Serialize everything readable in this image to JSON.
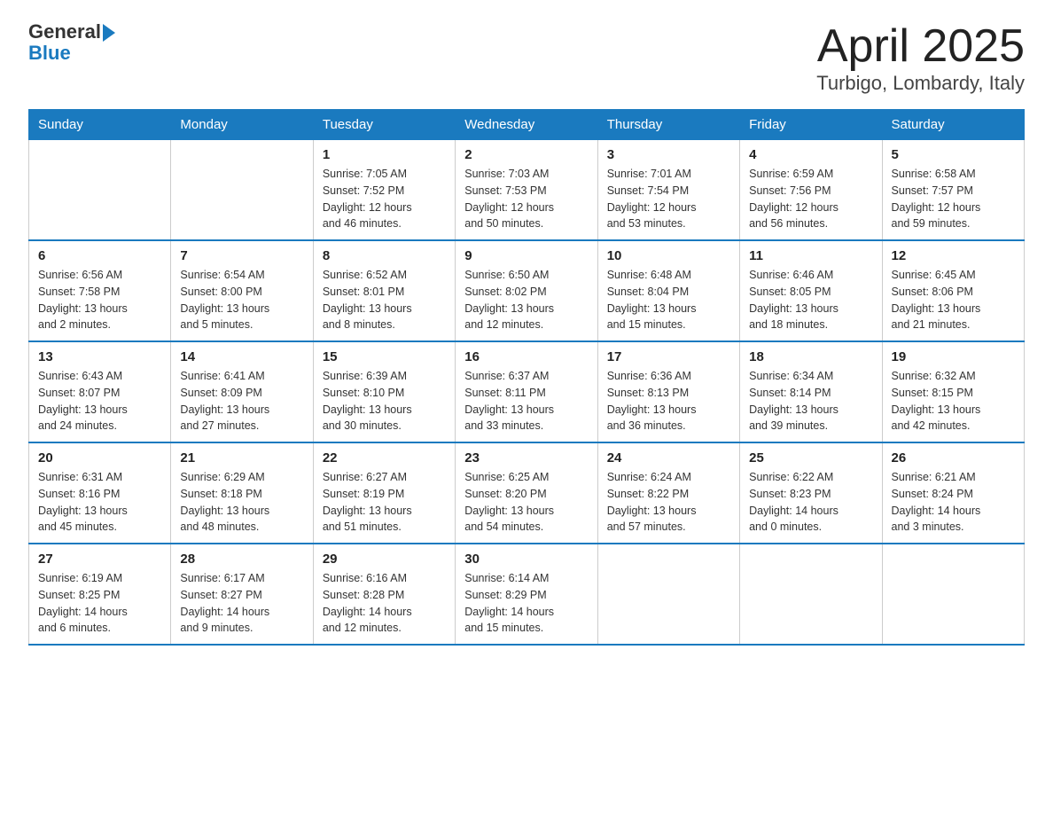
{
  "header": {
    "logo_general": "General",
    "logo_blue": "Blue",
    "title": "April 2025",
    "subtitle": "Turbigo, Lombardy, Italy"
  },
  "days_of_week": [
    "Sunday",
    "Monday",
    "Tuesday",
    "Wednesday",
    "Thursday",
    "Friday",
    "Saturday"
  ],
  "weeks": [
    [
      {
        "num": "",
        "info": ""
      },
      {
        "num": "",
        "info": ""
      },
      {
        "num": "1",
        "info": "Sunrise: 7:05 AM\nSunset: 7:52 PM\nDaylight: 12 hours\nand 46 minutes."
      },
      {
        "num": "2",
        "info": "Sunrise: 7:03 AM\nSunset: 7:53 PM\nDaylight: 12 hours\nand 50 minutes."
      },
      {
        "num": "3",
        "info": "Sunrise: 7:01 AM\nSunset: 7:54 PM\nDaylight: 12 hours\nand 53 minutes."
      },
      {
        "num": "4",
        "info": "Sunrise: 6:59 AM\nSunset: 7:56 PM\nDaylight: 12 hours\nand 56 minutes."
      },
      {
        "num": "5",
        "info": "Sunrise: 6:58 AM\nSunset: 7:57 PM\nDaylight: 12 hours\nand 59 minutes."
      }
    ],
    [
      {
        "num": "6",
        "info": "Sunrise: 6:56 AM\nSunset: 7:58 PM\nDaylight: 13 hours\nand 2 minutes."
      },
      {
        "num": "7",
        "info": "Sunrise: 6:54 AM\nSunset: 8:00 PM\nDaylight: 13 hours\nand 5 minutes."
      },
      {
        "num": "8",
        "info": "Sunrise: 6:52 AM\nSunset: 8:01 PM\nDaylight: 13 hours\nand 8 minutes."
      },
      {
        "num": "9",
        "info": "Sunrise: 6:50 AM\nSunset: 8:02 PM\nDaylight: 13 hours\nand 12 minutes."
      },
      {
        "num": "10",
        "info": "Sunrise: 6:48 AM\nSunset: 8:04 PM\nDaylight: 13 hours\nand 15 minutes."
      },
      {
        "num": "11",
        "info": "Sunrise: 6:46 AM\nSunset: 8:05 PM\nDaylight: 13 hours\nand 18 minutes."
      },
      {
        "num": "12",
        "info": "Sunrise: 6:45 AM\nSunset: 8:06 PM\nDaylight: 13 hours\nand 21 minutes."
      }
    ],
    [
      {
        "num": "13",
        "info": "Sunrise: 6:43 AM\nSunset: 8:07 PM\nDaylight: 13 hours\nand 24 minutes."
      },
      {
        "num": "14",
        "info": "Sunrise: 6:41 AM\nSunset: 8:09 PM\nDaylight: 13 hours\nand 27 minutes."
      },
      {
        "num": "15",
        "info": "Sunrise: 6:39 AM\nSunset: 8:10 PM\nDaylight: 13 hours\nand 30 minutes."
      },
      {
        "num": "16",
        "info": "Sunrise: 6:37 AM\nSunset: 8:11 PM\nDaylight: 13 hours\nand 33 minutes."
      },
      {
        "num": "17",
        "info": "Sunrise: 6:36 AM\nSunset: 8:13 PM\nDaylight: 13 hours\nand 36 minutes."
      },
      {
        "num": "18",
        "info": "Sunrise: 6:34 AM\nSunset: 8:14 PM\nDaylight: 13 hours\nand 39 minutes."
      },
      {
        "num": "19",
        "info": "Sunrise: 6:32 AM\nSunset: 8:15 PM\nDaylight: 13 hours\nand 42 minutes."
      }
    ],
    [
      {
        "num": "20",
        "info": "Sunrise: 6:31 AM\nSunset: 8:16 PM\nDaylight: 13 hours\nand 45 minutes."
      },
      {
        "num": "21",
        "info": "Sunrise: 6:29 AM\nSunset: 8:18 PM\nDaylight: 13 hours\nand 48 minutes."
      },
      {
        "num": "22",
        "info": "Sunrise: 6:27 AM\nSunset: 8:19 PM\nDaylight: 13 hours\nand 51 minutes."
      },
      {
        "num": "23",
        "info": "Sunrise: 6:25 AM\nSunset: 8:20 PM\nDaylight: 13 hours\nand 54 minutes."
      },
      {
        "num": "24",
        "info": "Sunrise: 6:24 AM\nSunset: 8:22 PM\nDaylight: 13 hours\nand 57 minutes."
      },
      {
        "num": "25",
        "info": "Sunrise: 6:22 AM\nSunset: 8:23 PM\nDaylight: 14 hours\nand 0 minutes."
      },
      {
        "num": "26",
        "info": "Sunrise: 6:21 AM\nSunset: 8:24 PM\nDaylight: 14 hours\nand 3 minutes."
      }
    ],
    [
      {
        "num": "27",
        "info": "Sunrise: 6:19 AM\nSunset: 8:25 PM\nDaylight: 14 hours\nand 6 minutes."
      },
      {
        "num": "28",
        "info": "Sunrise: 6:17 AM\nSunset: 8:27 PM\nDaylight: 14 hours\nand 9 minutes."
      },
      {
        "num": "29",
        "info": "Sunrise: 6:16 AM\nSunset: 8:28 PM\nDaylight: 14 hours\nand 12 minutes."
      },
      {
        "num": "30",
        "info": "Sunrise: 6:14 AM\nSunset: 8:29 PM\nDaylight: 14 hours\nand 15 minutes."
      },
      {
        "num": "",
        "info": ""
      },
      {
        "num": "",
        "info": ""
      },
      {
        "num": "",
        "info": ""
      }
    ]
  ]
}
